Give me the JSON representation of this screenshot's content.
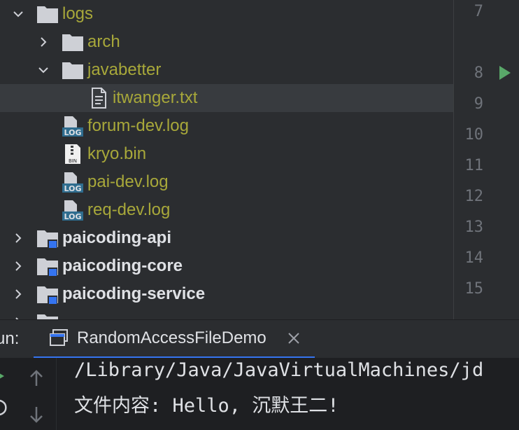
{
  "tree": {
    "items": [
      {
        "label": "logs"
      },
      {
        "label": "arch"
      },
      {
        "label": "javabetter"
      },
      {
        "label": "itwanger.txt"
      },
      {
        "label": "forum-dev.log"
      },
      {
        "label": "kryo.bin"
      },
      {
        "label": "pai-dev.log"
      },
      {
        "label": "req-dev.log"
      },
      {
        "label": "paicoding-api"
      },
      {
        "label": "paicoding-core"
      },
      {
        "label": "paicoding-service"
      }
    ],
    "file_badges": {
      "log": "LOG",
      "bin": "BIN"
    }
  },
  "gutter": {
    "lines": [
      "7",
      "8",
      "9",
      "10",
      "11",
      "12",
      "13",
      "14",
      "15"
    ]
  },
  "run": {
    "label": "un:",
    "tab_label": "RandomAccessFileDemo"
  },
  "console": {
    "lines": [
      "/Library/Java/JavaVirtualMachines/jd",
      "文件内容: Hello, 沉默王二!"
    ]
  },
  "colors": {
    "folder_text": "#a8a83a",
    "module_text": "#dfe1e5",
    "accent": "#3574f0",
    "run_green": "#59a869"
  }
}
